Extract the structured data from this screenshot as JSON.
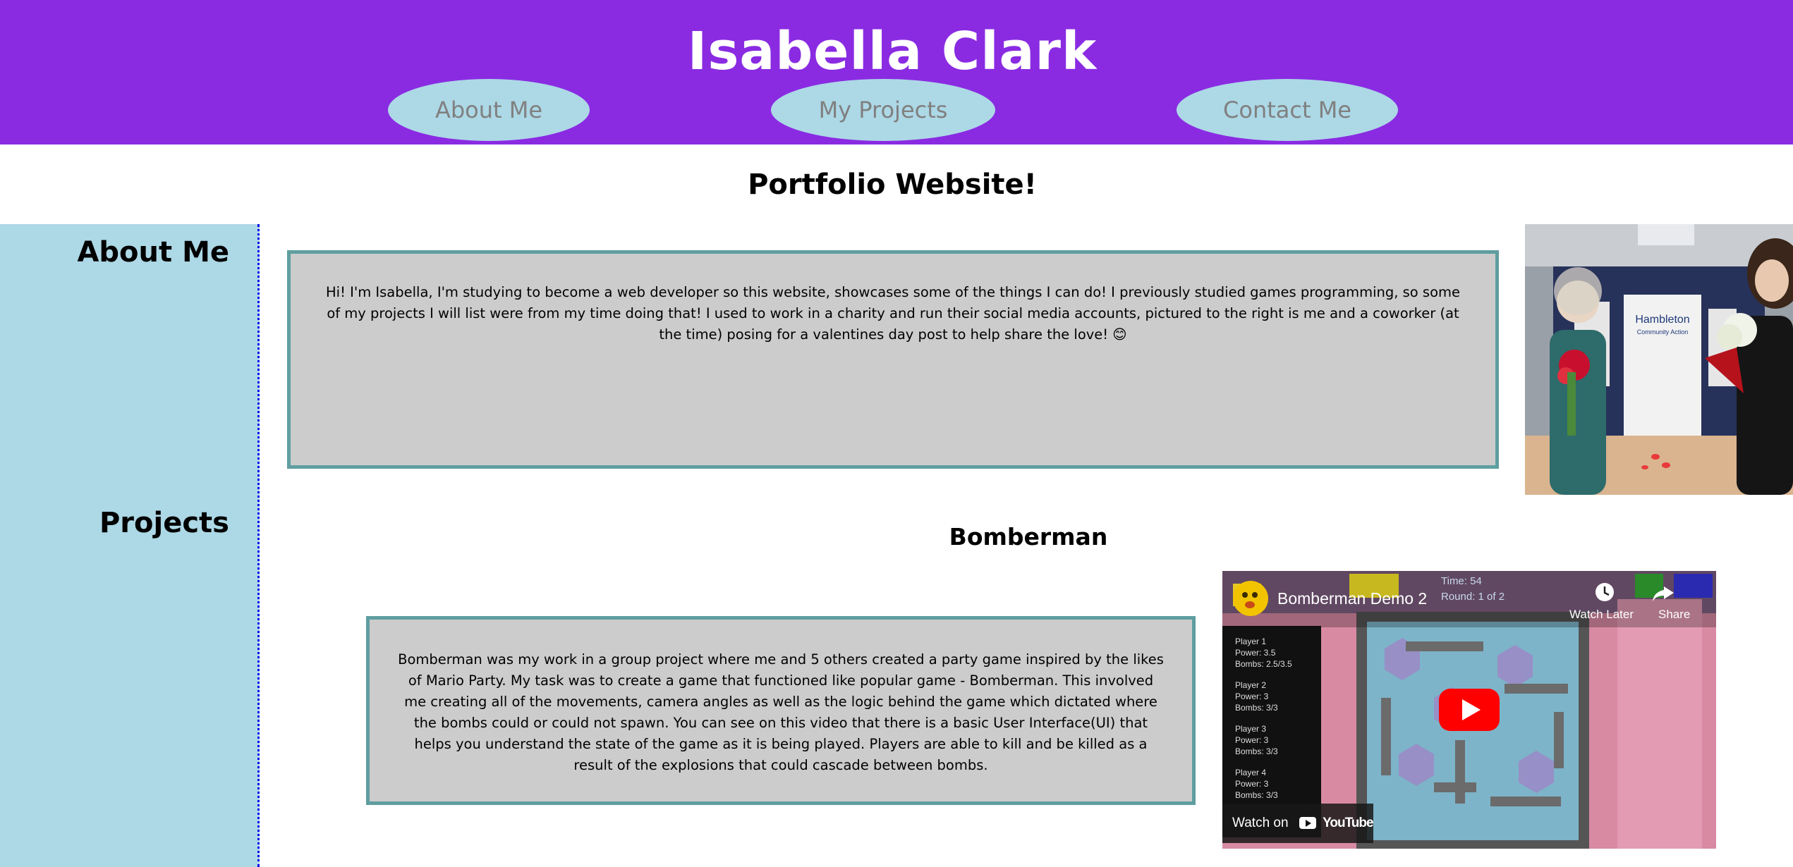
{
  "header": {
    "title": "Isabella Clark",
    "nav": [
      {
        "label": "About Me"
      },
      {
        "label": "My Projects"
      },
      {
        "label": "Contact Me"
      }
    ]
  },
  "subtitle": "Portfolio Website!",
  "sidebar": {
    "about_heading": "About Me",
    "projects_heading": "Projects"
  },
  "about": {
    "text": "Hi! I'm Isabella, I'm studying to become a web developer so this website, showcases some of the things I can do! I previously studied games programming, so some of my projects I will list were from my time doing that! I used to work in a charity and run their social media accounts, pictured to the right is me and a coworker (at the time) posing for a valentines day post to help share the love! 😊",
    "photo_sign_text": "Hambleton",
    "photo_sign_subtext": "Community Action"
  },
  "projects": [
    {
      "title": "Bomberman",
      "description": "Bomberman was my work in a group project where me and 5 others created a party game inspired by the likes of Mario Party. My task was to create a game that functioned like popular game - Bomberman. This involved me creating all of the movements, camera angles as well as the logic behind the game which dictated where the bombs could or could not spawn. You can see on this video that there is a basic User Interface(UI) that helps you understand the state of the game as it is being played. Players are able to kill and be killed as a result of the explosions that could cascade between bombs.",
      "video": {
        "title": "Bomberman Demo 2",
        "watch_later": "Watch Later",
        "share": "Share",
        "watch_on": "Watch on",
        "youtube": "YouTube",
        "hud_time": "Time: 54",
        "hud_round": "Round: 1 of 2",
        "players": [
          {
            "name": "Player 1",
            "power": "Power: 3.5",
            "bombs": "Bombs: 2.5/3.5"
          },
          {
            "name": "Player 2",
            "power": "Power: 3",
            "bombs": "Bombs: 3/3"
          },
          {
            "name": "Player 3",
            "power": "Power: 3",
            "bombs": "Bombs: 3/3"
          },
          {
            "name": "Player 4",
            "power": "Power: 3",
            "bombs": "Bombs: 3/3"
          }
        ]
      }
    }
  ],
  "colors": {
    "header_bg": "#8a2be2",
    "nav_pill": "#add8e6",
    "sidebar_bg": "#add8e6",
    "box_bg": "#cccccc",
    "box_border": "#5f9ea0"
  }
}
